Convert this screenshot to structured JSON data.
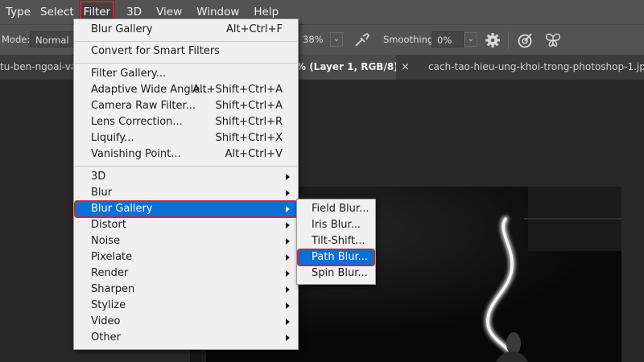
{
  "menubar": {
    "items": [
      "Type",
      "Select",
      "Filter",
      "3D",
      "View",
      "Window",
      "Help"
    ]
  },
  "options": {
    "mode_label": "Mode:",
    "mode_value": "Normal",
    "opacity_value": "38%",
    "smoothing_label": "Smoothing:",
    "smoothing_value": "0%"
  },
  "tabs": {
    "left": "tu-ben-ngoai-va",
    "active": "% (Layer 1, RGB/8) *",
    "close": "×",
    "right": "cach-tao-hieu-ung-khoi-trong-photoshop-1.jpg"
  },
  "filter_menu": {
    "blur_gallery_top": {
      "label": "Blur Gallery",
      "shortcut": "Alt+Ctrl+F"
    },
    "convert": {
      "label": "Convert for Smart Filters"
    },
    "filter_gallery": {
      "label": "Filter Gallery..."
    },
    "adaptive": {
      "label": "Adaptive Wide Angle...",
      "shortcut": "Alt+Shift+Ctrl+A"
    },
    "camera_raw": {
      "label": "Camera Raw Filter...",
      "shortcut": "Shift+Ctrl+A"
    },
    "lens": {
      "label": "Lens Correction...",
      "shortcut": "Shift+Ctrl+R"
    },
    "liquify": {
      "label": "Liquify...",
      "shortcut": "Shift+Ctrl+X"
    },
    "vanishing": {
      "label": "Vanishing Point...",
      "shortcut": "Alt+Ctrl+V"
    },
    "groups": [
      "3D",
      "Blur",
      "Blur Gallery",
      "Distort",
      "Noise",
      "Pixelate",
      "Render",
      "Sharpen",
      "Stylize",
      "Video",
      "Other"
    ]
  },
  "blur_gallery_submenu": [
    "Field Blur...",
    "Iris Blur...",
    "Tilt-Shift...",
    "Path Blur...",
    "Spin Blur..."
  ],
  "colors": {
    "selection": "#0a6fd6",
    "highlight_box": "#d8222a",
    "app_chrome": "#535353",
    "menu_bg": "#f0f0f0"
  },
  "icons": [
    "chevron-down-icon",
    "airbrush-icon",
    "gear-icon",
    "target-icon",
    "butterfly-icon"
  ]
}
